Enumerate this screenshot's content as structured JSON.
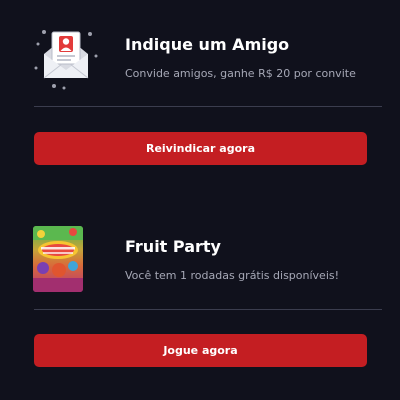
{
  "referral": {
    "title": "Indique um Amigo",
    "subtitle": "Convide amigos, ganhe R$ 20 por convite",
    "button_label": "Reivindicar agora",
    "icon": "envelope-invite-icon"
  },
  "game": {
    "title": "Fruit Party",
    "subtitle": "Você tem 1 rodadas grátis disponíveis!",
    "button_label": "Jogue agora",
    "thumbnail_icon": "fruit-party-thumbnail"
  },
  "colors": {
    "background": "#10111c",
    "button": "#c41e22",
    "subtitle_text": "#a6a8b6",
    "divider": "#3b3d4e"
  }
}
